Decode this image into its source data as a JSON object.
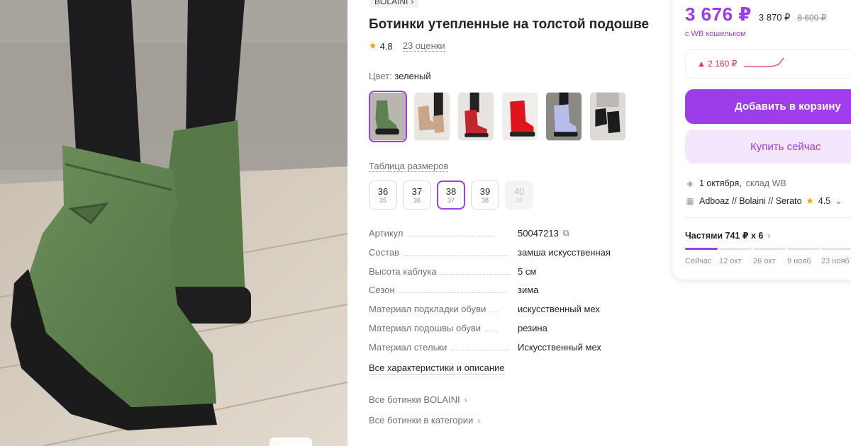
{
  "brand": {
    "name": "BOLAINI",
    "chevron_icon": "chevron-right-icon"
  },
  "product": {
    "title": "Ботинки утепленные на толстой подошве",
    "rating": "4.8",
    "reviews": "23 оценки"
  },
  "color": {
    "label": "Цвет:",
    "value": "зеленый"
  },
  "size_table_label": "Таблица размеров",
  "sizes": [
    {
      "ru": "36",
      "eu": "35",
      "state": "normal"
    },
    {
      "ru": "37",
      "eu": "36",
      "state": "normal"
    },
    {
      "ru": "38",
      "eu": "37",
      "state": "selected"
    },
    {
      "ru": "39",
      "eu": "38",
      "state": "normal"
    },
    {
      "ru": "40",
      "eu": "39",
      "state": "disabled"
    }
  ],
  "specs": [
    {
      "key": "Артикул",
      "value": "50047213"
    },
    {
      "key": "Состав",
      "value": "замша искусственная"
    },
    {
      "key": "Высота каблука",
      "value": "5 см"
    },
    {
      "key": "Сезон",
      "value": "зима"
    },
    {
      "key": "Материал подкладки обуви",
      "value": "искусственный мех"
    },
    {
      "key": "Материал подошвы обуви",
      "value": "резина"
    },
    {
      "key": "Материал стельки",
      "value": "Искусственный мех"
    }
  ],
  "all_characteristics": "Все характеристики и описание",
  "links": {
    "brand_boots": "Все ботинки BOLAINI",
    "category_boots": "Все ботинки в категории"
  },
  "price": {
    "current": "3 676 ₽",
    "wallet": "3 870 ₽",
    "old": "8 600 ₽",
    "wallet_label": "с WB кошельком",
    "history_change": "▲ 2 160 ₽"
  },
  "buttons": {
    "add_to_cart": "Добавить в корзину",
    "buy_now": "Купить сейчас"
  },
  "delivery": {
    "date": "1 октября,",
    "warehouse": "склад WB"
  },
  "seller": {
    "name": "Adboaz // Bolaini // Serato",
    "rating": "4.5"
  },
  "installments": {
    "label": "Частями 741 ₽ х 6",
    "dates": [
      "Сейчас",
      "12 окт",
      "26 окт",
      "9 нояб",
      "23 нояб"
    ]
  },
  "colors": {
    "accent": "#9b3de8",
    "accent_light": "#f4e6fd",
    "price_up": "#e5305a",
    "star": "#f6a000"
  }
}
